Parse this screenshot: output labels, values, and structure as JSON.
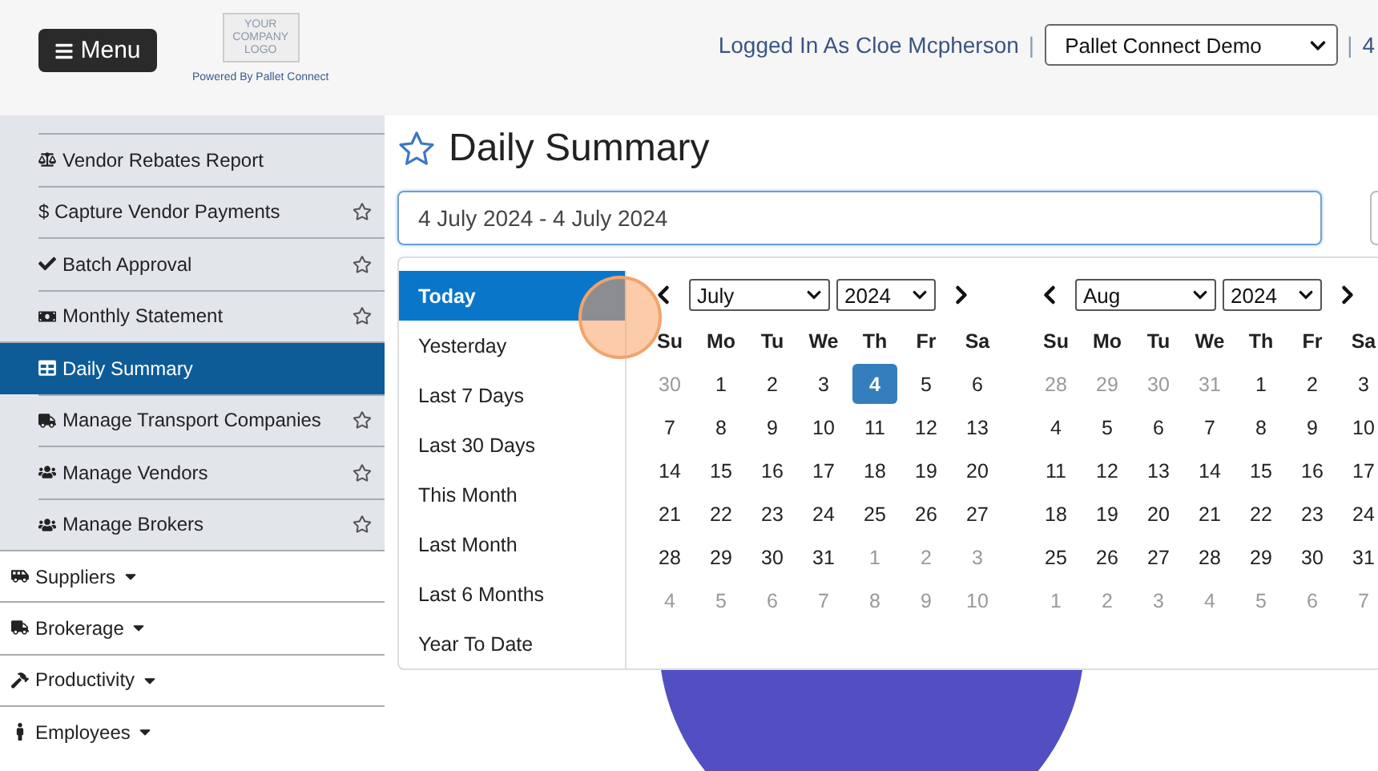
{
  "header": {
    "menu_button": "Menu",
    "logo_lines": [
      "YOUR",
      "COMPANY",
      "LOGO"
    ],
    "powered_by": "Powered By Pallet Connect",
    "logged_in": "Logged In As Cloe Mcpherson",
    "separator": "|",
    "company_select": "Pallet Connect Demo",
    "trailing_separator": "|",
    "trailing_text": "4"
  },
  "sidebar": {
    "items": [
      {
        "label": "Vendor Rebates Report",
        "kind": "sub",
        "selected": false,
        "favorite": false
      },
      {
        "label": "$ Capture Vendor Payments",
        "kind": "sub",
        "selected": false,
        "favorite": true
      },
      {
        "label": "Batch Approval",
        "kind": "sub",
        "selected": false,
        "favorite": true
      },
      {
        "label": "Monthly Statement",
        "kind": "sub",
        "selected": false,
        "favorite": true
      },
      {
        "label": "Daily Summary",
        "kind": "sub",
        "selected": true,
        "favorite": false
      },
      {
        "label": "Manage Transport Companies",
        "kind": "sub",
        "selected": false,
        "favorite": true
      },
      {
        "label": "Manage Vendors",
        "kind": "sub",
        "selected": false,
        "favorite": true
      },
      {
        "label": "Manage Brokers",
        "kind": "sub",
        "selected": false,
        "favorite": true
      },
      {
        "label": "Suppliers",
        "kind": "group",
        "selected": false,
        "favorite": false
      },
      {
        "label": "Brokerage",
        "kind": "group",
        "selected": false,
        "favorite": false
      },
      {
        "label": "Productivity",
        "kind": "group",
        "selected": false,
        "favorite": false
      },
      {
        "label": "Employees",
        "kind": "group",
        "selected": false,
        "favorite": false
      }
    ]
  },
  "page": {
    "title": "Daily Summary",
    "date_range": "4 July 2024 - 4 July 2024"
  },
  "date_picker": {
    "ranges": [
      {
        "label": "Today",
        "selected": true
      },
      {
        "label": "Yesterday",
        "selected": false
      },
      {
        "label": "Last 7 Days",
        "selected": false
      },
      {
        "label": "Last 30 Days",
        "selected": false
      },
      {
        "label": "This Month",
        "selected": false
      },
      {
        "label": "Last Month",
        "selected": false
      },
      {
        "label": "Last 6 Months",
        "selected": false
      },
      {
        "label": "Year To Date",
        "selected": false
      }
    ],
    "calendars": [
      {
        "month": "July",
        "year": "2024",
        "weekdays": [
          "Su",
          "Mo",
          "Tu",
          "We",
          "Th",
          "Fr",
          "Sa"
        ],
        "days": [
          {
            "label": "30",
            "muted": true,
            "selected": false
          },
          {
            "label": "1",
            "muted": false,
            "selected": false
          },
          {
            "label": "2",
            "muted": false,
            "selected": false
          },
          {
            "label": "3",
            "muted": false,
            "selected": false
          },
          {
            "label": "4",
            "muted": false,
            "selected": true
          },
          {
            "label": "5",
            "muted": false,
            "selected": false
          },
          {
            "label": "6",
            "muted": false,
            "selected": false
          },
          {
            "label": "7",
            "muted": false,
            "selected": false
          },
          {
            "label": "8",
            "muted": false,
            "selected": false
          },
          {
            "label": "9",
            "muted": false,
            "selected": false
          },
          {
            "label": "10",
            "muted": false,
            "selected": false
          },
          {
            "label": "11",
            "muted": false,
            "selected": false
          },
          {
            "label": "12",
            "muted": false,
            "selected": false
          },
          {
            "label": "13",
            "muted": false,
            "selected": false
          },
          {
            "label": "14",
            "muted": false,
            "selected": false
          },
          {
            "label": "15",
            "muted": false,
            "selected": false
          },
          {
            "label": "16",
            "muted": false,
            "selected": false
          },
          {
            "label": "17",
            "muted": false,
            "selected": false
          },
          {
            "label": "18",
            "muted": false,
            "selected": false
          },
          {
            "label": "19",
            "muted": false,
            "selected": false
          },
          {
            "label": "20",
            "muted": false,
            "selected": false
          },
          {
            "label": "21",
            "muted": false,
            "selected": false
          },
          {
            "label": "22",
            "muted": false,
            "selected": false
          },
          {
            "label": "23",
            "muted": false,
            "selected": false
          },
          {
            "label": "24",
            "muted": false,
            "selected": false
          },
          {
            "label": "25",
            "muted": false,
            "selected": false
          },
          {
            "label": "26",
            "muted": false,
            "selected": false
          },
          {
            "label": "27",
            "muted": false,
            "selected": false
          },
          {
            "label": "28",
            "muted": false,
            "selected": false
          },
          {
            "label": "29",
            "muted": false,
            "selected": false
          },
          {
            "label": "30",
            "muted": false,
            "selected": false
          },
          {
            "label": "31",
            "muted": false,
            "selected": false
          },
          {
            "label": "1",
            "muted": true,
            "selected": false
          },
          {
            "label": "2",
            "muted": true,
            "selected": false
          },
          {
            "label": "3",
            "muted": true,
            "selected": false
          },
          {
            "label": "4",
            "muted": true,
            "selected": false
          },
          {
            "label": "5",
            "muted": true,
            "selected": false
          },
          {
            "label": "6",
            "muted": true,
            "selected": false
          },
          {
            "label": "7",
            "muted": true,
            "selected": false
          },
          {
            "label": "8",
            "muted": true,
            "selected": false
          },
          {
            "label": "9",
            "muted": true,
            "selected": false
          },
          {
            "label": "10",
            "muted": true,
            "selected": false
          }
        ]
      },
      {
        "month": "Aug",
        "year": "2024",
        "weekdays": [
          "Su",
          "Mo",
          "Tu",
          "We",
          "Th",
          "Fr",
          "Sa"
        ],
        "days": [
          {
            "label": "28",
            "muted": true,
            "selected": false
          },
          {
            "label": "29",
            "muted": true,
            "selected": false
          },
          {
            "label": "30",
            "muted": true,
            "selected": false
          },
          {
            "label": "31",
            "muted": true,
            "selected": false
          },
          {
            "label": "1",
            "muted": false,
            "selected": false
          },
          {
            "label": "2",
            "muted": false,
            "selected": false
          },
          {
            "label": "3",
            "muted": false,
            "selected": false
          },
          {
            "label": "4",
            "muted": false,
            "selected": false
          },
          {
            "label": "5",
            "muted": false,
            "selected": false
          },
          {
            "label": "6",
            "muted": false,
            "selected": false
          },
          {
            "label": "7",
            "muted": false,
            "selected": false
          },
          {
            "label": "8",
            "muted": false,
            "selected": false
          },
          {
            "label": "9",
            "muted": false,
            "selected": false
          },
          {
            "label": "10",
            "muted": false,
            "selected": false
          },
          {
            "label": "11",
            "muted": false,
            "selected": false
          },
          {
            "label": "12",
            "muted": false,
            "selected": false
          },
          {
            "label": "13",
            "muted": false,
            "selected": false
          },
          {
            "label": "14",
            "muted": false,
            "selected": false
          },
          {
            "label": "15",
            "muted": false,
            "selected": false
          },
          {
            "label": "16",
            "muted": false,
            "selected": false
          },
          {
            "label": "17",
            "muted": false,
            "selected": false
          },
          {
            "label": "18",
            "muted": false,
            "selected": false
          },
          {
            "label": "19",
            "muted": false,
            "selected": false
          },
          {
            "label": "20",
            "muted": false,
            "selected": false
          },
          {
            "label": "21",
            "muted": false,
            "selected": false
          },
          {
            "label": "22",
            "muted": false,
            "selected": false
          },
          {
            "label": "23",
            "muted": false,
            "selected": false
          },
          {
            "label": "24",
            "muted": false,
            "selected": false
          },
          {
            "label": "25",
            "muted": false,
            "selected": false
          },
          {
            "label": "26",
            "muted": false,
            "selected": false
          },
          {
            "label": "27",
            "muted": false,
            "selected": false
          },
          {
            "label": "28",
            "muted": false,
            "selected": false
          },
          {
            "label": "29",
            "muted": false,
            "selected": false
          },
          {
            "label": "30",
            "muted": false,
            "selected": false
          },
          {
            "label": "31",
            "muted": false,
            "selected": false
          },
          {
            "label": "1",
            "muted": true,
            "selected": false
          },
          {
            "label": "2",
            "muted": true,
            "selected": false
          },
          {
            "label": "3",
            "muted": true,
            "selected": false
          },
          {
            "label": "4",
            "muted": true,
            "selected": false
          },
          {
            "label": "5",
            "muted": true,
            "selected": false
          },
          {
            "label": "6",
            "muted": true,
            "selected": false
          },
          {
            "label": "7",
            "muted": true,
            "selected": false
          }
        ]
      }
    ]
  }
}
